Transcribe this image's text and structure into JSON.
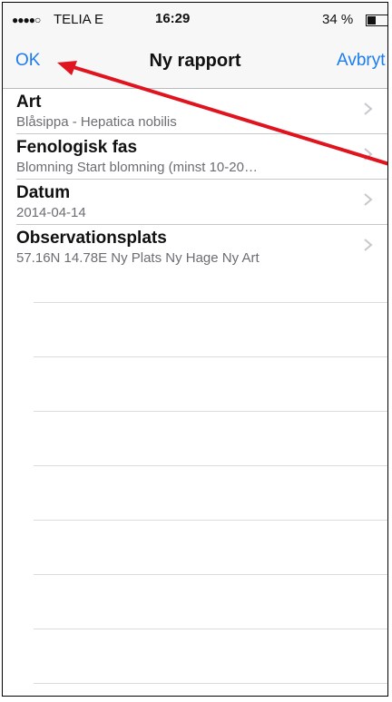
{
  "status_bar": {
    "signal": "●●●●○",
    "carrier": "TELIA  E",
    "time": "16:29",
    "battery_percent": "34 %",
    "battery_level": 0.34
  },
  "nav": {
    "ok_label": "OK",
    "title": "Ny rapport",
    "cancel_label": "Avbryt"
  },
  "rows": [
    {
      "title": "Art",
      "subtitle": "Blåsippa - Hepatica nobilis"
    },
    {
      "title": "Fenologisk fas",
      "subtitle": "Blomning Start blomning (minst 10-20…"
    },
    {
      "title": "Datum",
      "subtitle": "2014-04-14"
    },
    {
      "title": "Observationsplats",
      "subtitle": "57.16N 14.78E Ny Plats Ny Hage Ny Art"
    }
  ],
  "annotation": {
    "arrow_color": "#e0141e"
  },
  "colors": {
    "accent": "#1b7cf2"
  }
}
